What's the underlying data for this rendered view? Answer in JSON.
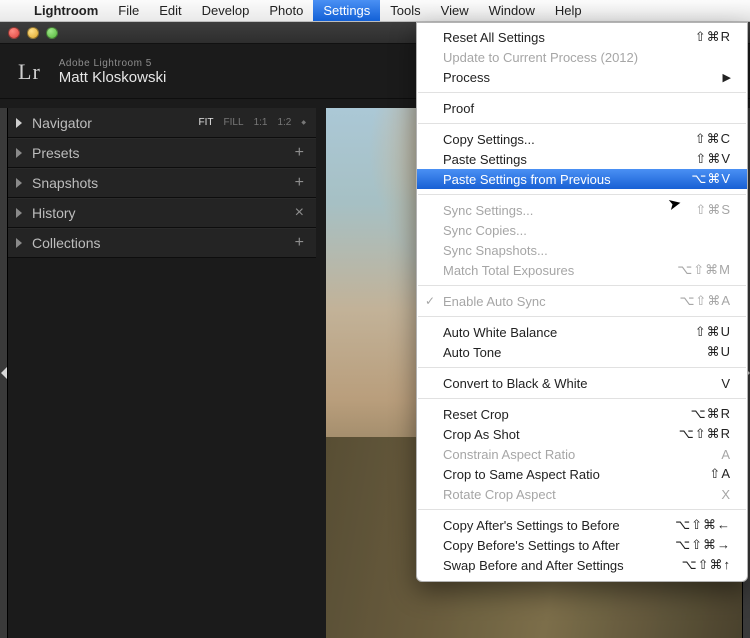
{
  "os": {
    "apple_icon": "",
    "menu": {
      "app": "Lightroom",
      "items": [
        "File",
        "Edit",
        "Develop",
        "Photo",
        "Settings",
        "Tools",
        "View",
        "Window",
        "Help"
      ],
      "active_index": 4
    }
  },
  "app": {
    "logo": "Lr",
    "product_line": "Adobe Lightroom 5",
    "profile_name": "Matt Kloskowski",
    "navigator": {
      "label": "Navigator",
      "options": [
        "FIT",
        "FILL",
        "1:1",
        "1:2"
      ],
      "selected": "FIT",
      "extra_glyph": "∶"
    },
    "panels": [
      {
        "label": "Presets",
        "action_glyph": "+"
      },
      {
        "label": "Snapshots",
        "action_glyph": "+"
      },
      {
        "label": "History",
        "action_glyph": "×"
      },
      {
        "label": "Collections",
        "action_glyph": "+"
      }
    ]
  },
  "menu_dropdown": {
    "groups": [
      [
        {
          "label": "Reset All Settings",
          "shortcut": "⇧⌘R",
          "enabled": true
        },
        {
          "label": "Update to Current Process (2012)",
          "shortcut": "",
          "enabled": false
        },
        {
          "label": "Process",
          "shortcut": "",
          "enabled": true,
          "submenu": true
        }
      ],
      [
        {
          "label": "Proof",
          "shortcut": "",
          "enabled": true
        }
      ],
      [
        {
          "label": "Copy Settings...",
          "shortcut": "⇧⌘C",
          "enabled": true
        },
        {
          "label": "Paste Settings",
          "shortcut": "⇧⌘V",
          "enabled": true
        },
        {
          "label": "Paste Settings from Previous",
          "shortcut": "⌥⌘V",
          "enabled": true,
          "selected": true
        }
      ],
      [
        {
          "label": "Sync Settings...",
          "shortcut": "⇧⌘S",
          "enabled": false
        },
        {
          "label": "Sync Copies...",
          "shortcut": "",
          "enabled": false
        },
        {
          "label": "Sync Snapshots...",
          "shortcut": "",
          "enabled": false
        },
        {
          "label": "Match Total Exposures",
          "shortcut": "⌥⇧⌘M",
          "enabled": false
        }
      ],
      [
        {
          "label": "Enable Auto Sync",
          "shortcut": "⌥⇧⌘A",
          "enabled": false,
          "checked": true
        }
      ],
      [
        {
          "label": "Auto White Balance",
          "shortcut": "⇧⌘U",
          "enabled": true
        },
        {
          "label": "Auto Tone",
          "shortcut": "⌘U",
          "enabled": true
        }
      ],
      [
        {
          "label": "Convert to Black & White",
          "shortcut": "V",
          "enabled": true
        }
      ],
      [
        {
          "label": "Reset Crop",
          "shortcut": "⌥⌘R",
          "enabled": true
        },
        {
          "label": "Crop As Shot",
          "shortcut": "⌥⇧⌘R",
          "enabled": true
        },
        {
          "label": "Constrain Aspect Ratio",
          "shortcut": "A",
          "enabled": false
        },
        {
          "label": "Crop to Same Aspect Ratio",
          "shortcut": "⇧A",
          "enabled": true
        },
        {
          "label": "Rotate Crop Aspect",
          "shortcut": "X",
          "enabled": false
        }
      ],
      [
        {
          "label": "Copy After's Settings to Before",
          "shortcut": "⌥⇧⌘←",
          "enabled": true
        },
        {
          "label": "Copy Before's Settings to After",
          "shortcut": "⌥⇧⌘→",
          "enabled": true
        },
        {
          "label": "Swap Before and After Settings",
          "shortcut": "⌥⇧⌘↑",
          "enabled": true
        }
      ]
    ]
  }
}
